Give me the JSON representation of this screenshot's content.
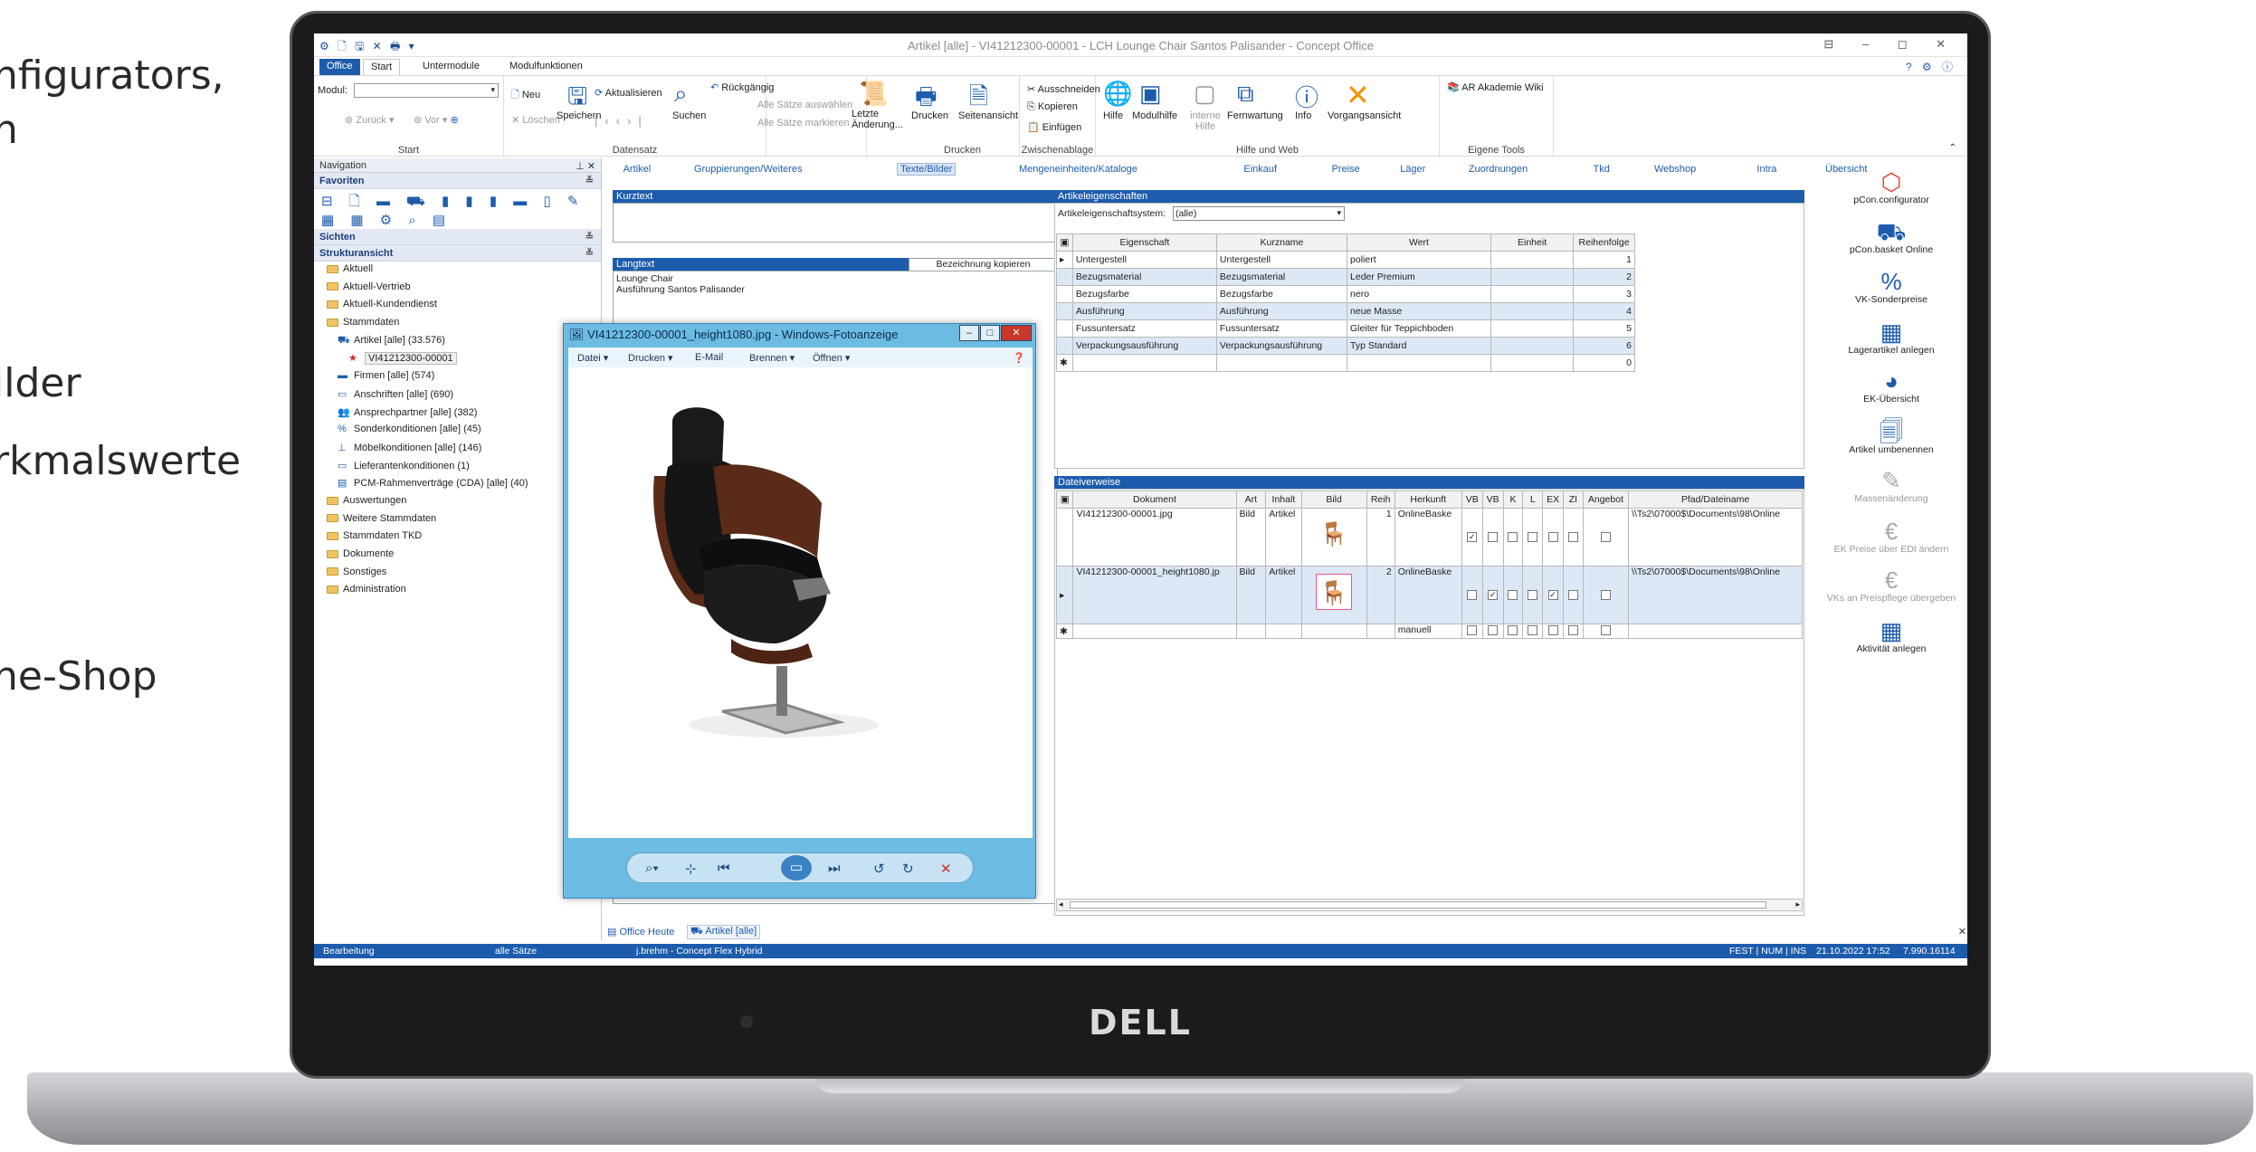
{
  "marketing": {
    "lines": [
      "nfigurators,",
      "n",
      "ilder",
      "rkmalswerte",
      "ne-Shop"
    ]
  },
  "brand": {
    "logo_text": "DELL"
  },
  "window": {
    "title": "Artikel [alle] - VI41212300-00001 - LCH Lounge Chair Santos Palisander - Concept Office",
    "quick_access": "⚙ 🗋 🖫 ✕ 🖶 ▾",
    "controls": "⊟ – ◻ ✕"
  },
  "ribbon_tabs": [
    {
      "label": "Office"
    },
    {
      "label": "Start"
    },
    {
      "label": "Untermodule"
    },
    {
      "label": "Modulfunktionen"
    }
  ],
  "help_icons": "? ⚙ ⓘ",
  "ribbon": {
    "start": {
      "modul_label": "Modul:",
      "back": "Zurück",
      "forward": "Vor",
      "group": "Start"
    },
    "datensatz": {
      "neu": "Neu",
      "loeschen": "Löschen",
      "speichern": "Speichern",
      "aktualisieren": "Aktualisieren",
      "suchen": "Suchen",
      "rueckgaengig": "Rückgängig",
      "alle_auswaehlen": "Alle Sätze auswählen",
      "alle_markieren": "Alle Sätze markieren",
      "letzte_aenderung": "Letzte Änderung...",
      "group": "Datensatz"
    },
    "drucken": {
      "drucken": "Drucken",
      "seitenansicht": "Seitenansicht",
      "group": "Drucken"
    },
    "zwischenablage": {
      "ausschneiden": "Ausschneiden",
      "kopieren": "Kopieren",
      "einfuegen": "Einfügen",
      "group": "Zwischenablage"
    },
    "hilfe": {
      "hilfe": "Hilfe",
      "modulhilfe": "Modulhilfe",
      "interne_hilfe": "interne Hilfe",
      "fernwartung": "Fernwartung",
      "info": "Info",
      "vorgangsansicht": "Vorgangsansicht",
      "group": "Hilfe und Web"
    },
    "eigene": {
      "akademie": "AR Akademie Wiki",
      "group": "Eigene Tools"
    }
  },
  "navigation": {
    "header": "Navigation",
    "favoriten": "Favoriten",
    "favorite_icons": "⊟ 🗋 ▬ ⛟ ▮ ▮ ▮ ▬ ▯ ✎ ▭",
    "favorite_icons_row2": "▦ ▦ ⚙ ⌕ ▤",
    "sichten": "Sichten",
    "strukturansicht": "Strukturansicht",
    "tree": [
      {
        "label": "Aktuell",
        "level": 0,
        "kind": "folder"
      },
      {
        "label": "Aktuell-Vertrieb",
        "level": 0,
        "kind": "folder"
      },
      {
        "label": "Aktuell-Kundendienst",
        "level": 0,
        "kind": "folder"
      },
      {
        "label": "Stammdaten",
        "level": 0,
        "kind": "folder"
      },
      {
        "label": "Artikel [alle] (33.576)",
        "level": 1,
        "kind": "item",
        "icon": "⛟"
      },
      {
        "label": "VI41212300-00001",
        "level": 2,
        "kind": "item",
        "icon": "★",
        "selected": true
      },
      {
        "label": "Firmen [alle] (574)",
        "level": 1,
        "kind": "item",
        "icon": "▬"
      },
      {
        "label": "Anschriften [alle] (690)",
        "level": 1,
        "kind": "item",
        "icon": "▭"
      },
      {
        "label": "Ansprechpartner [alle] (382)",
        "level": 1,
        "kind": "item",
        "icon": "👥"
      },
      {
        "label": "Sonderkonditionen [alle] (45)",
        "level": 1,
        "kind": "item",
        "icon": "%"
      },
      {
        "label": "Möbelkonditionen [alle] (146)",
        "level": 1,
        "kind": "item",
        "icon": "⊥"
      },
      {
        "label": "Lieferantenkonditionen (1)",
        "level": 1,
        "kind": "item",
        "icon": "▭"
      },
      {
        "label": "PCM-Rahmenverträge (CDA) [alle] (40)",
        "level": 1,
        "kind": "item",
        "icon": "▤"
      },
      {
        "label": "Auswertungen",
        "level": 0,
        "kind": "folder"
      },
      {
        "label": "Weitere Stammdaten",
        "level": 0,
        "kind": "folder"
      },
      {
        "label": "Stammdaten TKD",
        "level": 0,
        "kind": "folder"
      },
      {
        "label": "Dokumente",
        "level": 0,
        "kind": "folder"
      },
      {
        "label": "Sonstiges",
        "level": 0,
        "kind": "folder"
      },
      {
        "label": "Administration",
        "level": 0,
        "kind": "folder"
      }
    ]
  },
  "content_tabs": [
    "Artikel",
    "Gruppierungen/Weiteres",
    "Texte/Bilder",
    "Mengeneinheiten/Kataloge",
    "Einkauf",
    "Preise",
    "Läger",
    "Zuordnungen",
    "Tkd",
    "Webshop",
    "Intra",
    "Übersicht"
  ],
  "active_content_tab": "Texte/Bilder",
  "kurztext": {
    "header": "Kurztext",
    "value": ""
  },
  "langtext": {
    "header": "Langtext",
    "copy_button": "Bezeichnung kopieren",
    "lines": [
      "Lounge Chair",
      "Ausführung Santos Palisander"
    ]
  },
  "eigenschaften": {
    "header": "Artikeleigenschaften",
    "system_label": "Artikeleigenschaftsystem:",
    "system_value": "(alle)",
    "columns": [
      "Eigenschaft",
      "Kurzname",
      "Wert",
      "Einheit",
      "Reihenfolge"
    ],
    "rows": [
      [
        "Untergestell",
        "Untergestell",
        "poliert",
        "",
        "1"
      ],
      [
        "Bezugsmaterial",
        "Bezugsmaterial",
        "Leder Premium",
        "",
        "2"
      ],
      [
        "Bezugsfarbe",
        "Bezugsfarbe",
        "nero",
        "",
        "3"
      ],
      [
        "Ausführung",
        "Ausführung",
        "neue Masse",
        "",
        "4"
      ],
      [
        "Fussuntersatz",
        "Fussuntersatz",
        "Gleiter für Teppichboden",
        "",
        "5"
      ],
      [
        "Verpackungsausführung",
        "Verpackungsausführung",
        "Typ Standard",
        "",
        "6"
      ],
      [
        "",
        "",
        "",
        "",
        "0"
      ]
    ]
  },
  "dateiverweise": {
    "header": "Dateiverweise",
    "columns": [
      "Dokument",
      "Art",
      "Inhalt",
      "Bild",
      "Reih",
      "Herkunft",
      "VB",
      "VB",
      "K",
      "L",
      "EX",
      "ZI",
      "Angebot",
      "Pfad/Dateiname"
    ],
    "rows": [
      {
        "dokument": "VI41212300-00001.jpg",
        "art": "Bild",
        "inhalt": "Artikel",
        "reih": "1",
        "herkunft": "OnlineBaske",
        "checks": [
          true,
          false,
          false,
          false,
          false,
          false
        ],
        "angebot": false,
        "pfad": "\\\\Ts2\\07000$\\Documents\\98\\Online"
      },
      {
        "dokument": "VI41212300-00001_height1080.jp",
        "art": "Bild",
        "inhalt": "Artikel",
        "reih": "2",
        "herkunft": "OnlineBaske",
        "checks": [
          false,
          true,
          false,
          false,
          true,
          false
        ],
        "angebot": false,
        "pfad": "\\\\Ts2\\07000$\\Documents\\98\\Online"
      },
      {
        "dokument": "",
        "art": "",
        "inhalt": "",
        "reih": "",
        "herkunft": "manuell",
        "checks": [
          false,
          false,
          false,
          false,
          false,
          false
        ],
        "angebot": false,
        "pfad": ""
      }
    ]
  },
  "viewer": {
    "title": "VI41212300-00001_height1080.jpg - Windows-Fotoanzeige",
    "menu": [
      "Datei ▾",
      "Drucken ▾",
      "E-Mail",
      "Brennen ▾",
      "Öffnen ▾"
    ]
  },
  "bottom_tabs": [
    "Office Heute",
    "Artikel [alle]"
  ],
  "statusbar": {
    "mode": "Bearbeitung",
    "scope": "alle Sätze",
    "user": "j.brehm - Concept Flex Hybrid",
    "flags": "FEST | NUM | INS",
    "datetime": "21.10.2022  17:52",
    "version": "7.990.16114"
  },
  "sidebar_actions": [
    {
      "label": "pCon.configurator",
      "icon": "pcon-configurator-icon",
      "glyph": "⬡",
      "enabled": true
    },
    {
      "label": "pCon.basket Online",
      "icon": "basket-icon",
      "glyph": "⛟",
      "enabled": true
    },
    {
      "label": "VK-Sonderpreise",
      "icon": "percent-icon",
      "glyph": "%",
      "enabled": true
    },
    {
      "label": "Lagerartikel anlegen",
      "icon": "warehouse-icon",
      "glyph": "▦",
      "enabled": true
    },
    {
      "label": "EK-Übersicht",
      "icon": "pie-icon",
      "glyph": "◕",
      "enabled": true
    },
    {
      "label": "Artikel umbenennen",
      "icon": "rename-icon",
      "glyph": "🗐",
      "enabled": true
    },
    {
      "label": "Massenänderung",
      "icon": "mass-edit-icon",
      "glyph": "✎",
      "enabled": false
    },
    {
      "label": "EK Preise über EDI ändern",
      "icon": "euro-icon",
      "glyph": "€",
      "enabled": false
    },
    {
      "label": "VKs an Preispflege übergeben",
      "icon": "euro-transfer-icon",
      "glyph": "€",
      "enabled": false
    },
    {
      "label": "Aktivität anlegen",
      "icon": "calendar-icon",
      "glyph": "▦",
      "enabled": true
    }
  ]
}
